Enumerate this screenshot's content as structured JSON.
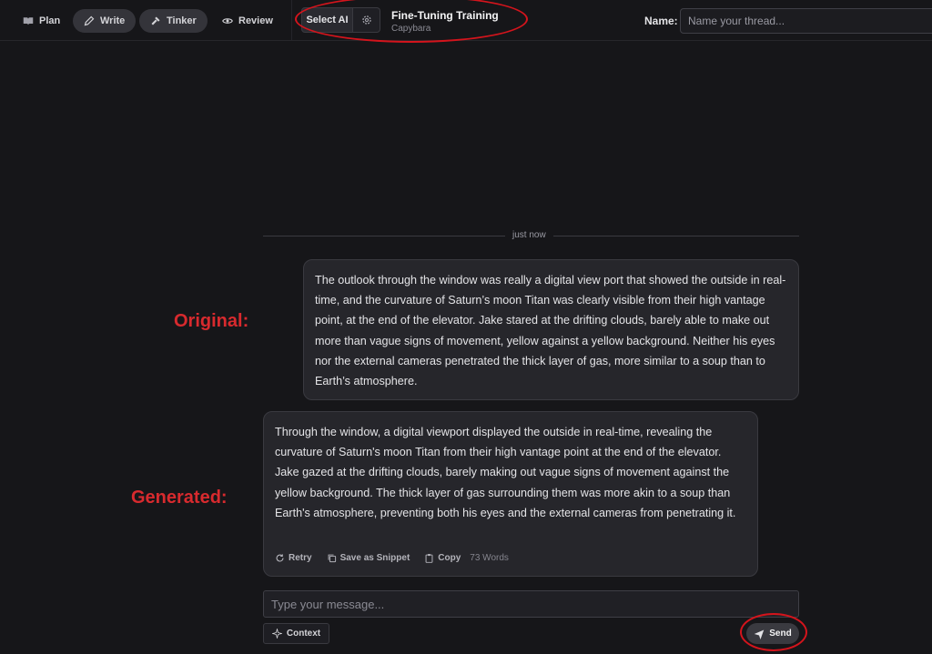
{
  "modes": {
    "plan": "Plan",
    "write": "Write",
    "tinker": "Tinker",
    "review": "Review"
  },
  "ai": {
    "select_label": "Select AI",
    "model_title": "Fine-Tuning Training",
    "model_subtitle": "Capybara"
  },
  "thread": {
    "name_label": "Name:",
    "name_placeholder": "Name your thread..."
  },
  "timeline": {
    "timestamp": "just now"
  },
  "annotations": {
    "original": "Original:",
    "generated": "Generated:"
  },
  "messages": {
    "original_text": "The outlook through the window was really a digital view port that showed the outside in real-time, and the curvature of Saturn’s moon Titan was clearly visible from their high vantage point, at the end of the elevator. Jake stared at the drifting clouds, barely able to make out more than vague signs of movement, yellow against a yellow background. Neither his eyes nor the external cameras penetrated the thick layer of gas, more similar to a soup than to Earth’s atmosphere.",
    "generated_text": "Through the window, a digital viewport displayed the outside in real-time, revealing the curvature of Saturn's moon Titan from their high vantage point at the end of the elevator. Jake gazed at the drifting clouds, barely making out vague signs of movement against the yellow background. The thick layer of gas surrounding them was more akin to a soup than Earth's atmosphere, preventing both his eyes and the external cameras from penetrating it."
  },
  "message_actions": {
    "retry": "Retry",
    "save_snippet": "Save as Snippet",
    "copy": "Copy",
    "word_count": "73 Words"
  },
  "composer": {
    "placeholder": "Type your message...",
    "context_label": "Context",
    "send_label": "Send"
  },
  "colors": {
    "background": "#161619",
    "bubble": "#26262b",
    "annotation_red": "#d82a2e"
  }
}
